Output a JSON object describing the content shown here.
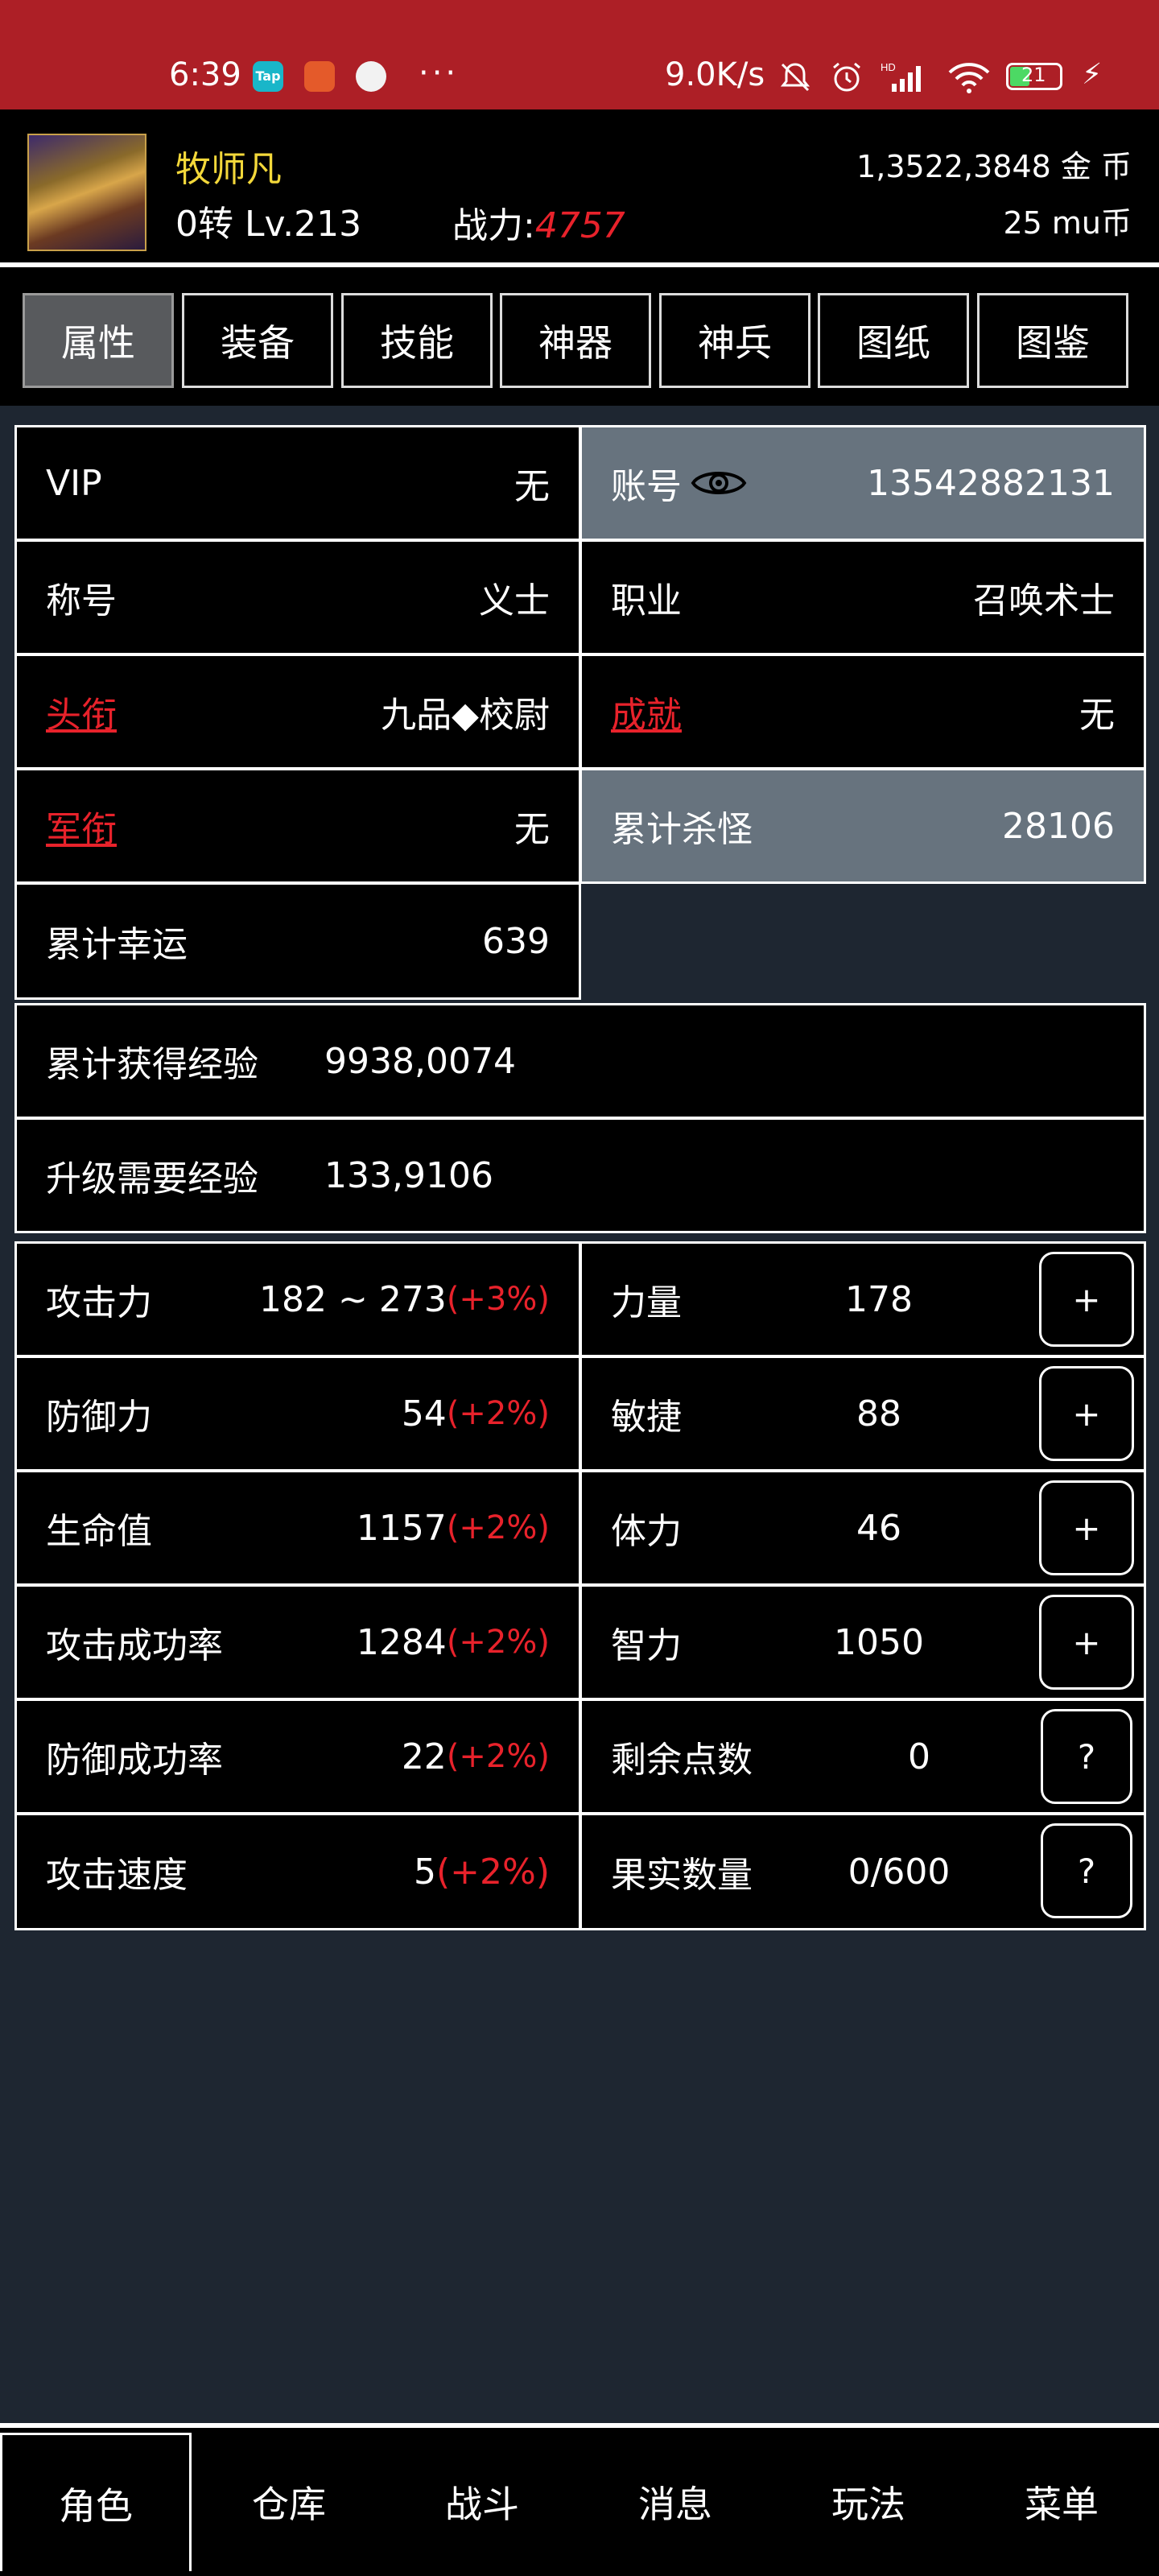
{
  "status_bar": {
    "time": "6:39",
    "speed": "9.0K/s",
    "battery": "21",
    "app_icons": [
      "Tap",
      "",
      ""
    ],
    "hd_label": "HD"
  },
  "header": {
    "name": "牧师凡",
    "rebirth_level": "0转 Lv.213",
    "power_label": "战力:",
    "power_value": "4757",
    "gold": "1,3522,3848 金  币",
    "mu": "25 mu币"
  },
  "tabs": [
    "属性",
    "装备",
    "技能",
    "神器",
    "神兵",
    "图纸",
    "图鉴"
  ],
  "info": {
    "vip_label": "VIP",
    "vip_value": "无",
    "account_label": "账号",
    "account_value": "13542882131",
    "title_label": "称号",
    "title_value": "义士",
    "job_label": "职业",
    "job_value": "召唤术士",
    "rank_label": "头衔",
    "rank_value": "九品◆校尉",
    "achievement_label": "成就",
    "achievement_value": "无",
    "military_label": "军衔",
    "military_value": "无",
    "kills_label": "累计杀怪",
    "kills_value": "28106",
    "luck_label": "累计幸运",
    "luck_value": "639",
    "exp_total_label": "累计获得经验",
    "exp_total_value": "9938,0074",
    "exp_need_label": "升级需要经验",
    "exp_need_value": "133,9106"
  },
  "combat_stats": [
    {
      "label": "攻击力",
      "value": "182 ~ 273",
      "bonus": "(+3%)"
    },
    {
      "label": "防御力",
      "value": "54",
      "bonus": "(+2%)"
    },
    {
      "label": "生命值",
      "value": "1157",
      "bonus": "(+2%)"
    },
    {
      "label": "攻击成功率",
      "value": "1284",
      "bonus": "(+2%)"
    },
    {
      "label": "防御成功率",
      "value": "22",
      "bonus": "(+2%)"
    },
    {
      "label": "攻击速度",
      "value": "5",
      "bonus": "(+2%)"
    }
  ],
  "attributes": [
    {
      "label": "力量",
      "value": "178",
      "button": "+"
    },
    {
      "label": "敏捷",
      "value": "88",
      "button": "+"
    },
    {
      "label": "体力",
      "value": "46",
      "button": "+"
    },
    {
      "label": "智力",
      "value": "1050",
      "button": "+"
    },
    {
      "label": "剩余点数",
      "value": "0",
      "button": "?"
    },
    {
      "label": "果实数量",
      "value": "0/600",
      "button": "?"
    }
  ],
  "bottom_nav": [
    "角色",
    "仓库",
    "战斗",
    "消息",
    "玩法",
    "菜单"
  ],
  "colors": {
    "status_bar": "#ad1f26",
    "background": "#1e2631",
    "gray_cell": "#67737e",
    "accent_red": "#e8222b",
    "name_yellow": "#f3d83a"
  }
}
